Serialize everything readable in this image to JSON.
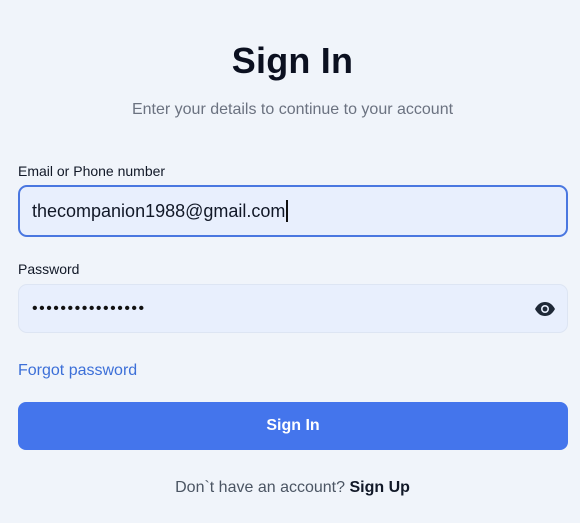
{
  "header": {
    "title": "Sign In",
    "subtitle": "Enter your details to continue to your account"
  },
  "form": {
    "email": {
      "label": "Email or Phone number",
      "value": "thecompanion1988@gmail.com"
    },
    "password": {
      "label": "Password",
      "masked_value": "••••••••••••••••",
      "toggle_icon": "eye-icon"
    },
    "forgot_link": "Forgot password",
    "submit_label": "Sign In"
  },
  "footer": {
    "prompt": "Don`t have an account?",
    "signup_link": "Sign Up"
  },
  "colors": {
    "accent": "#4475ec",
    "link": "#3c6fd8",
    "input_bg": "#e8effd",
    "page_bg": "#f0f4fa"
  }
}
